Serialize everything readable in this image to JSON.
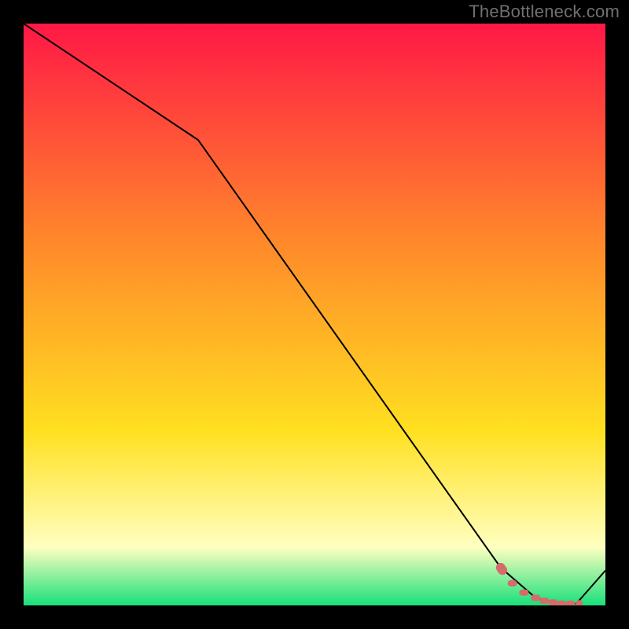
{
  "watermark": "TheBottleneck.com",
  "chart_data": {
    "type": "line",
    "title": "",
    "xlabel": "",
    "ylabel": "",
    "xlim": [
      0,
      100
    ],
    "ylim": [
      0,
      100
    ],
    "series": [
      {
        "name": "curve",
        "style": "solid",
        "color": "#000000",
        "x": [
          0,
          30,
          82,
          88,
          92,
          95,
          100
        ],
        "y": [
          100,
          80,
          6.5,
          1.3,
          0.3,
          0.3,
          6
        ]
      },
      {
        "name": "highlight-dots",
        "style": "dashed-dots",
        "color": "#d76a6a",
        "x": [
          82,
          84,
          86,
          88,
          89.5,
          91,
          92.5,
          94,
          95.5
        ],
        "y": [
          6.5,
          3.8,
          2.2,
          1.3,
          0.8,
          0.5,
          0.3,
          0.3,
          0.3
        ]
      }
    ],
    "background_gradient": {
      "top": "#ff1846",
      "mid1": "#ff8a2a",
      "mid2": "#ffe020",
      "mid3": "#ffffc0",
      "bottom": "#18e07a"
    }
  }
}
